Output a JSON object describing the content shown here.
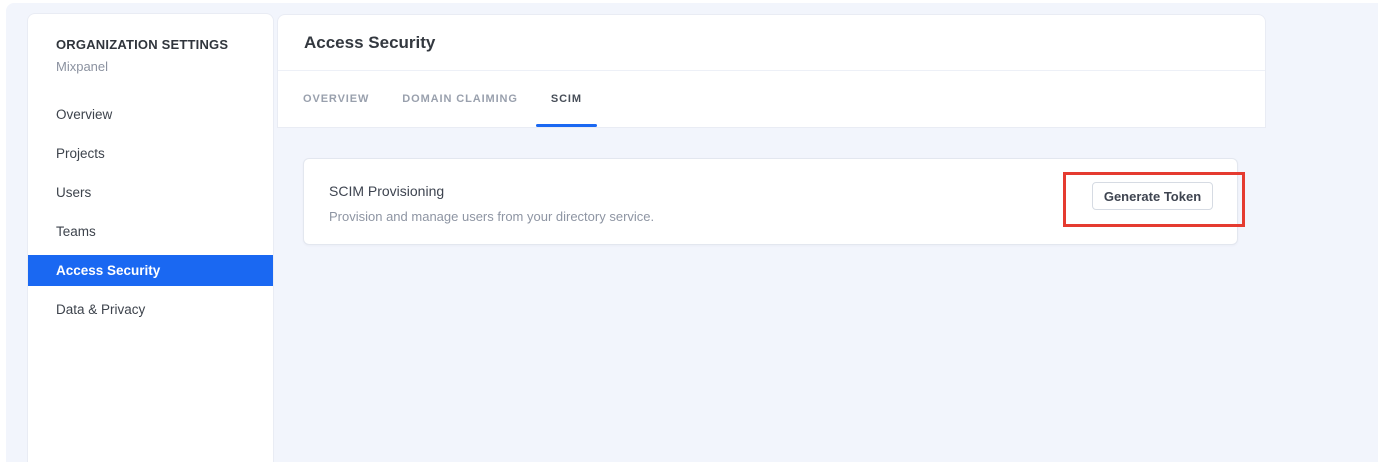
{
  "sidebar": {
    "heading": "ORGANIZATION SETTINGS",
    "org_name": "Mixpanel",
    "items": [
      {
        "label": "Overview",
        "active": false
      },
      {
        "label": "Projects",
        "active": false
      },
      {
        "label": "Users",
        "active": false
      },
      {
        "label": "Teams",
        "active": false
      },
      {
        "label": "Access Security",
        "active": true
      },
      {
        "label": "Data & Privacy",
        "active": false
      }
    ]
  },
  "main": {
    "title": "Access Security",
    "tabs": [
      {
        "label": "OVERVIEW",
        "active": false
      },
      {
        "label": "DOMAIN CLAIMING",
        "active": false
      },
      {
        "label": "SCIM",
        "active": true
      }
    ],
    "card": {
      "title": "SCIM Provisioning",
      "description": "Provision and manage users from your directory service.",
      "button_label": "Generate Token"
    }
  },
  "annotation": {
    "type": "highlight-box",
    "target": "generate-token-button"
  },
  "colors": {
    "accent_blue": "#1a68f2",
    "annotation_red": "#e53b30",
    "app_background": "#f2f5fc"
  }
}
